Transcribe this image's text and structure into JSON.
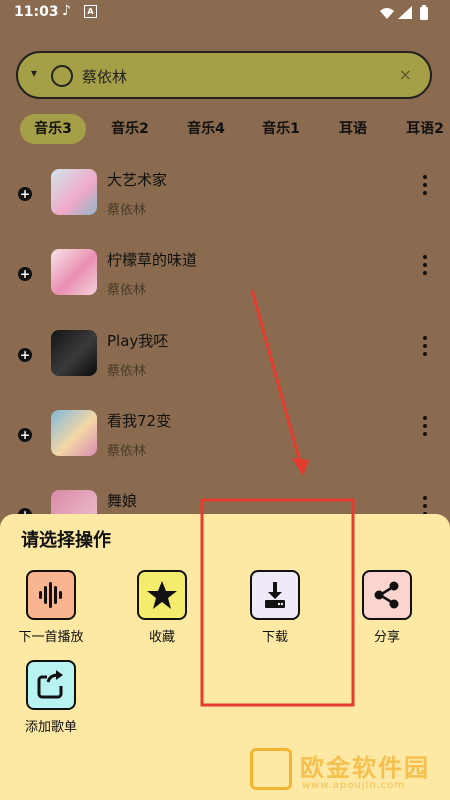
{
  "status": {
    "time": "11:03",
    "music_glyph": "♪",
    "a_glyph": "A"
  },
  "search": {
    "value": "蔡依林",
    "caret": "▾",
    "clear": "×"
  },
  "tabs": [
    {
      "label": "音乐3",
      "active": true
    },
    {
      "label": "音乐2",
      "active": false
    },
    {
      "label": "音乐4",
      "active": false
    },
    {
      "label": "音乐1",
      "active": false
    },
    {
      "label": "耳语",
      "active": false
    },
    {
      "label": "耳语2",
      "active": false
    }
  ],
  "songs": [
    {
      "title": "大艺术家",
      "artist": "蔡依林"
    },
    {
      "title": "柠檬草的味道",
      "artist": "蔡依林"
    },
    {
      "title": "Play我呸",
      "artist": "蔡依林"
    },
    {
      "title": "看我72变",
      "artist": "蔡依林"
    },
    {
      "title": "舞娘",
      "artist": ""
    }
  ],
  "sheet": {
    "title": "请选择操作",
    "actions": [
      {
        "label": "下一首播放",
        "color": "#f9b58f"
      },
      {
        "label": "收藏",
        "color": "#f3ec6c"
      },
      {
        "label": "下载",
        "color": "#efe9f8"
      },
      {
        "label": "分享",
        "color": "#fbd3cf"
      },
      {
        "label": "添加歌单",
        "color": "#b8f3f1"
      }
    ]
  },
  "watermark": {
    "text": "欧金软件园",
    "url": "www.apoujin.com"
  },
  "colors": {
    "background": "#8b6b4f",
    "accent": "#a5a047",
    "sheet": "#fde8a4",
    "highlight": "#e53b2f"
  }
}
